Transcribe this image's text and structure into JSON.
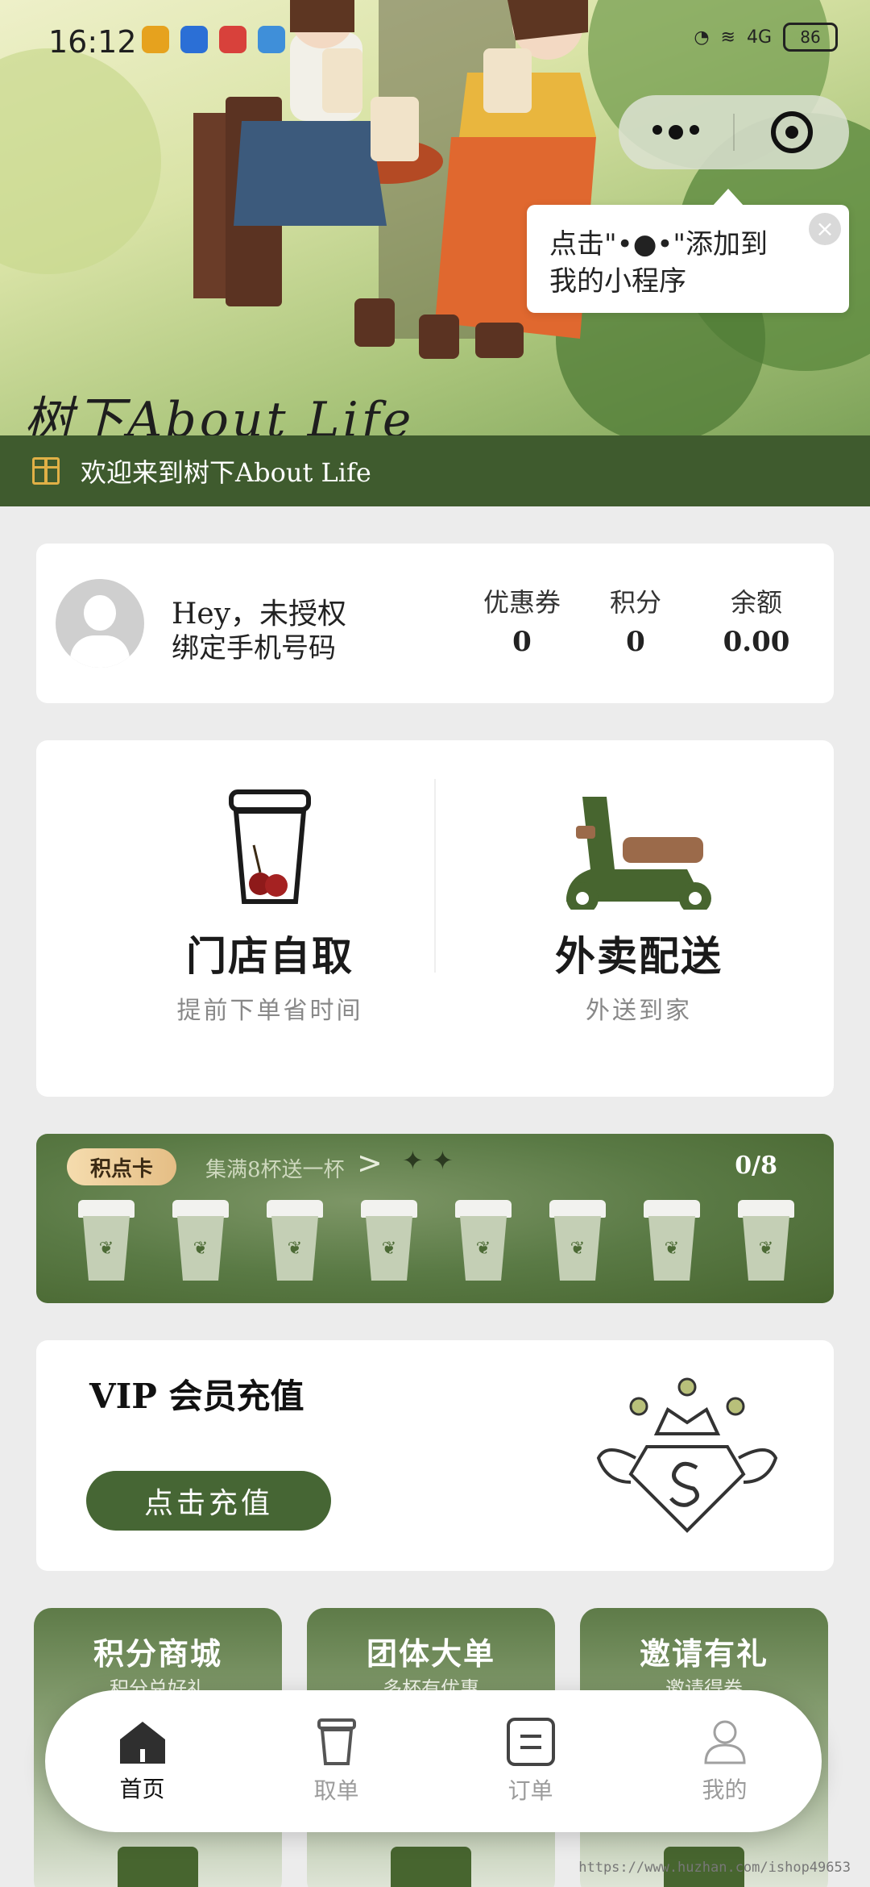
{
  "status_bar": {
    "time": "16:12",
    "signal_label": "4G",
    "battery": "86"
  },
  "hero": {
    "title": "树下About Life"
  },
  "capsule": {
    "more_icon": "more-dots-icon",
    "close_icon": "target-icon"
  },
  "tooltip": {
    "text": "点击\"●●●\"添加到我的小程序",
    "line1": "点击\"•●•\"添加到",
    "line2": "我的小程序",
    "close": "×"
  },
  "welcome": {
    "text": "欢迎来到树下About Life"
  },
  "user": {
    "greeting": "Hey，未授权",
    "bind_phone": "绑定手机号码",
    "stats": [
      {
        "label": "优惠券",
        "value": "0"
      },
      {
        "label": "积分",
        "value": "0"
      },
      {
        "label": "余额",
        "value": "0.00"
      }
    ]
  },
  "order_options": [
    {
      "title": "门店自取",
      "subtitle": "提前下单省时间",
      "icon": "takeaway-cup-icon"
    },
    {
      "title": "外卖配送",
      "subtitle": "外送到家",
      "icon": "scooter-icon"
    }
  ],
  "stamp_card": {
    "badge": "积点卡",
    "desc": "集满8杯送一杯",
    "arrow": ">",
    "sparkle": "✦ ✦",
    "progress": "0/8",
    "cups_total": 8,
    "cups_filled": 0
  },
  "vip": {
    "title": "VIP 会员充值",
    "button": "点击充值"
  },
  "tiles": [
    {
      "title": "积分商城",
      "subtitle": "积分兑好礼"
    },
    {
      "title": "团体大单",
      "subtitle": "多杯有优惠"
    },
    {
      "title": "邀请有礼",
      "subtitle": "邀请得券"
    }
  ],
  "tabbar": [
    {
      "label": "首页",
      "icon": "home-icon",
      "active": true
    },
    {
      "label": "取单",
      "icon": "cup-icon",
      "active": false
    },
    {
      "label": "订单",
      "icon": "order-icon",
      "active": false
    },
    {
      "label": "我的",
      "icon": "user-icon",
      "active": false
    }
  ],
  "watermark": "https://www.huzhan.com/ishop49653",
  "colors": {
    "brand_green": "#3f5b2e",
    "button_green": "#466634",
    "gold": "#e0b046"
  }
}
